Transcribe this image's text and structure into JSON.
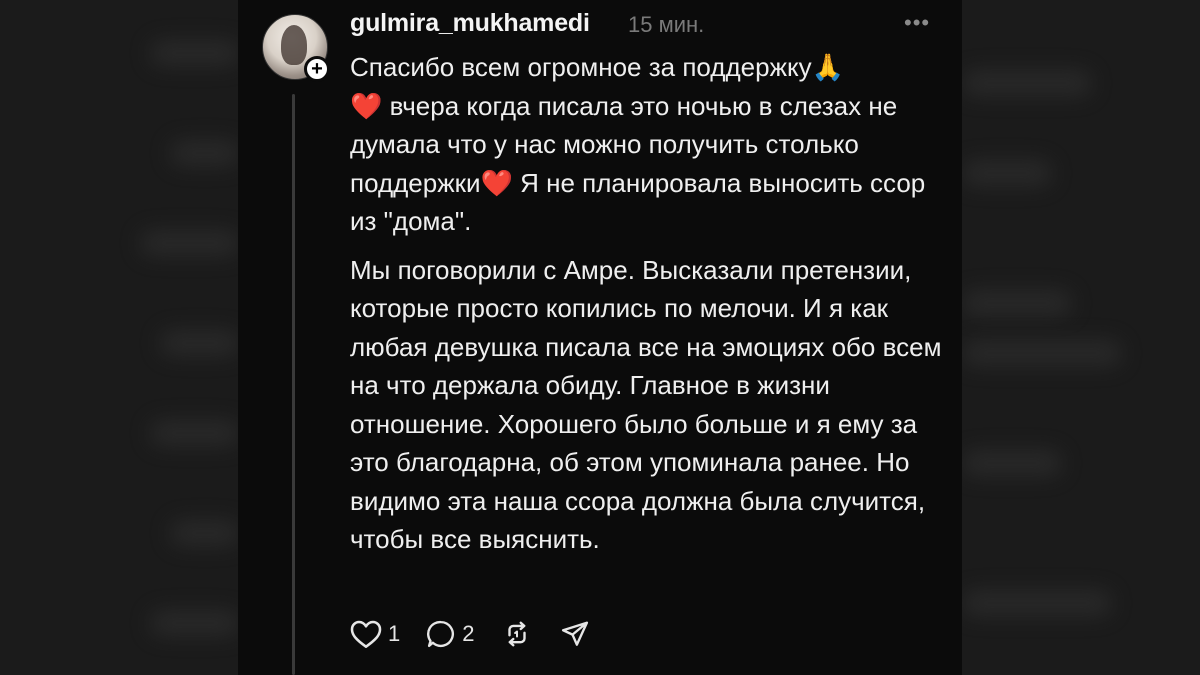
{
  "post": {
    "username": "gulmira_mukhamedi",
    "time": "15 мин.",
    "more_label": "•••",
    "follow_symbol": "+",
    "paragraph1": {
      "part1": "Спасибо всем огромное за поддержку🙏",
      "heart1": "❤️",
      "part2": " вчера когда писала это ночью в слезах не думала что у нас можно получить столько поддержки",
      "heart2": "❤️",
      "part3": " Я не планировала выносить ссор из \"дома\"."
    },
    "paragraph2": "Мы поговорили с Амре. Высказали претензии, которые просто копились по мелочи. И я как любая девушка писала все на эмоциях обо всем на что держала обиду. Главное в жизни отношение. Хорошего было больше и я ему за это благодарна, об этом упоминала ранее. Но видимо эта наша ссора должна была случится, чтобы все выяснить.",
    "actions": {
      "likes": "1",
      "comments": "2",
      "like_icon": "heart-outline-icon",
      "comment_icon": "speech-bubble-icon",
      "repost_icon": "repost-icon",
      "share_icon": "send-icon"
    }
  },
  "colors": {
    "background": "#0b0b0b",
    "text": "#efefef",
    "muted": "#7a7a7a",
    "heart": "#e5243b"
  }
}
